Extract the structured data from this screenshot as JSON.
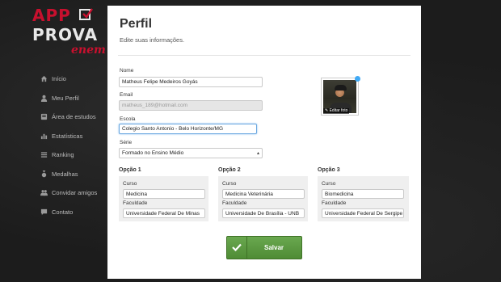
{
  "logo": {
    "line1": "APP",
    "line2": "PROVA",
    "line3": "enem"
  },
  "nav": [
    {
      "label": "Início",
      "icon": "home-icon"
    },
    {
      "label": "Meu Perfil",
      "icon": "user-icon"
    },
    {
      "label": "Área de estudos",
      "icon": "book-icon"
    },
    {
      "label": "Estatísticas",
      "icon": "chart-icon"
    },
    {
      "label": "Ranking",
      "icon": "list-icon"
    },
    {
      "label": "Medalhas",
      "icon": "medal-icon"
    },
    {
      "label": "Convidar amigos",
      "icon": "users-icon"
    },
    {
      "label": "Contato",
      "icon": "chat-icon"
    }
  ],
  "page": {
    "title": "Perfil",
    "subtitle": "Edite suas informações."
  },
  "form": {
    "name_label": "Nome",
    "name_value": "Matheus Felipe Medeiros Goyás",
    "email_label": "Email",
    "email_value": "matheus_189@hotmail.com",
    "school_label": "Escola",
    "school_value": "Colegio Santo Antonio - Belo Horizonte/MG",
    "grade_label": "Série",
    "grade_value": "Formado no Ensino Médio"
  },
  "photo": {
    "edit_label": "Editar foto"
  },
  "options": [
    {
      "title": "Opção 1",
      "course_label": "Curso",
      "course": "Medicina",
      "faculty_label": "Faculdade",
      "faculty": "Universidade Federal De Minas"
    },
    {
      "title": "Opção 2",
      "course_label": "Curso",
      "course": "Medicina Veterinária",
      "faculty_label": "Faculdade",
      "faculty": "Universidade De Brasília - UNB"
    },
    {
      "title": "Opção 3",
      "course_label": "Curso",
      "course": "Biomedicina",
      "faculty_label": "Faculdade",
      "faculty": "Universidade Federal De Sergipe"
    }
  ],
  "save_label": "Salvar",
  "colors": {
    "brand_red": "#c8102e",
    "save_green": "#5a9a3f",
    "focus_blue": "#6aa7e0"
  }
}
